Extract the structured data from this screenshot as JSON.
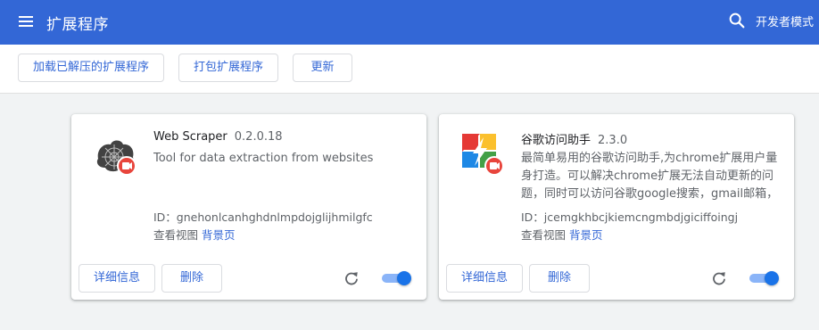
{
  "header": {
    "title": "扩展程序",
    "dev_mode_label": "开发者模式"
  },
  "toolbar": {
    "load_unpacked": "加载已解压的扩展程序",
    "pack": "打包扩展程序",
    "update": "更新"
  },
  "extensions": [
    {
      "name": "Web Scraper",
      "version": "0.2.0.18",
      "description": "Tool for data extraction from websites",
      "id_text": "ID：gnehonlcanhghdnlmpdojglijhmilgfc",
      "inspect_label": "查看视图",
      "background_link": "背景页",
      "details_label": "详细信息",
      "remove_label": "删除",
      "enabled": true,
      "icon": "spider-web-icon"
    },
    {
      "name": "谷歌访问助手",
      "version": "2.3.0",
      "description": "最简单易用的谷歌访问助手,为chrome扩展用户量身打造。可以解决chrome扩展无法自动更新的问题，同时可以访问谷歌google搜索，gmail邮箱，",
      "id_text": "ID：jcemgkhbcjkiemcngmbdjgiciffoingj",
      "inspect_label": "查看视图",
      "background_link": "背景页",
      "details_label": "详细信息",
      "remove_label": "删除",
      "enabled": true,
      "icon": "google-access-helper-icon"
    }
  ],
  "colors": {
    "header_bg": "#3367d6",
    "accent": "#1a73e8",
    "badge": "#e8453c"
  }
}
